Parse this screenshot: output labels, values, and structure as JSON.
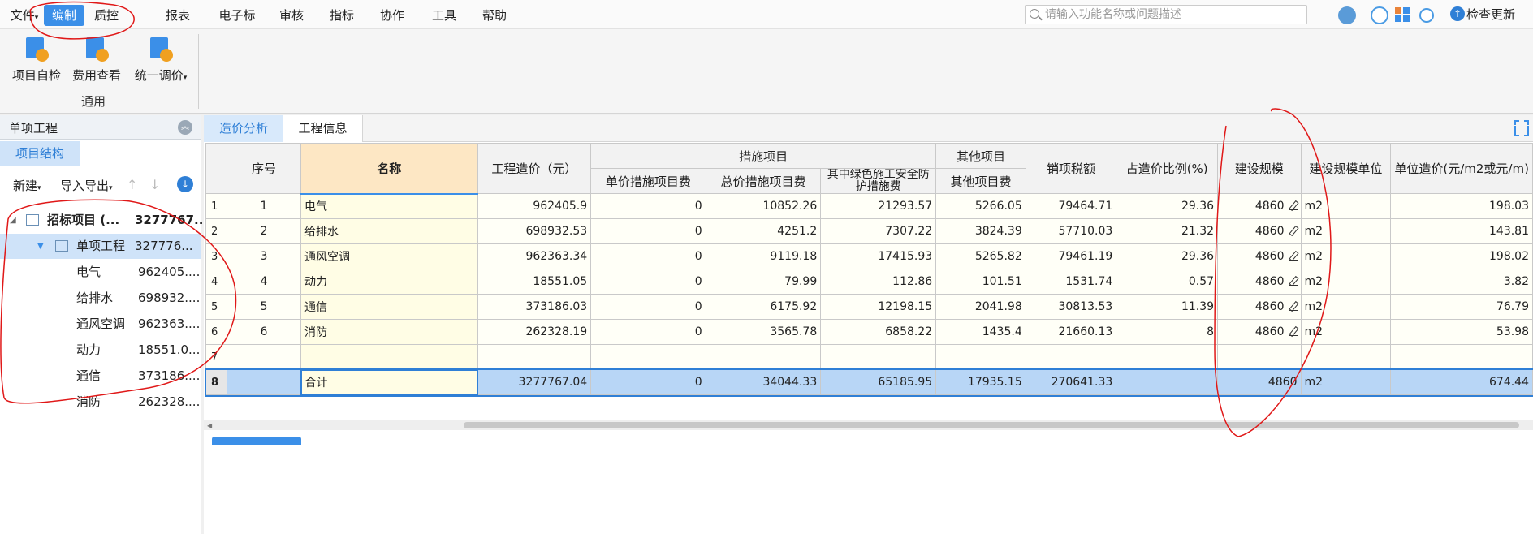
{
  "menu": {
    "items": [
      "文件",
      "编制",
      "质控",
      "报表",
      "电子标",
      "审核",
      "指标",
      "协作",
      "工具",
      "帮助"
    ],
    "active_index": 1
  },
  "search": {
    "placeholder": "请输入功能名称或问题描述"
  },
  "toolbar_right": {
    "check_update": "检查更新"
  },
  "ribbon": {
    "buttons": [
      "项目自检",
      "费用查看",
      "统一调价"
    ],
    "group_label": "通用"
  },
  "left": {
    "title": "单项工程",
    "tab": "项目结构",
    "actions": {
      "new": "新建",
      "import_export": "导入导出"
    },
    "tree": [
      {
        "label": "招标项目 (...",
        "value": "3277767..."
      },
      {
        "label": "单项工程",
        "value": "327776..."
      },
      {
        "label": "电气",
        "value": "962405...."
      },
      {
        "label": "给排水",
        "value": "698932...."
      },
      {
        "label": "通风空调",
        "value": "962363...."
      },
      {
        "label": "动力",
        "value": "18551.0..."
      },
      {
        "label": "通信",
        "value": "373186...."
      },
      {
        "label": "消防",
        "value": "262328...."
      }
    ]
  },
  "tabs": [
    "造价分析",
    "工程信息"
  ],
  "grid": {
    "headers": {
      "seq": "序号",
      "name": "名称",
      "cost": "工程造价（元）",
      "measures": "措施项目",
      "measures_unit": "单价措施项目费",
      "measures_total": "总价措施项目费",
      "green": "其中绿色施工安全防护措施费",
      "other": "其他项目",
      "other_sub": "其他项目费",
      "tax": "销项税额",
      "ratio": "占造价比例(%)",
      "scale": "建设规模",
      "scale_unit": "建设规模单位",
      "unit_cost": "单位造价(元/m2或元/m)"
    },
    "rows": [
      {
        "rn": "1",
        "seq": "1",
        "name": "电气",
        "cost": "962405.9",
        "mu": "0",
        "mt": "10852.26",
        "green": "21293.57",
        "other": "5266.05",
        "tax": "79464.71",
        "ratio": "29.36",
        "scale": "4860",
        "unit": "m2",
        "uc": "198.03"
      },
      {
        "rn": "2",
        "seq": "2",
        "name": "给排水",
        "cost": "698932.53",
        "mu": "0",
        "mt": "4251.2",
        "green": "7307.22",
        "other": "3824.39",
        "tax": "57710.03",
        "ratio": "21.32",
        "scale": "4860",
        "unit": "m2",
        "uc": "143.81"
      },
      {
        "rn": "3",
        "seq": "3",
        "name": "通风空调",
        "cost": "962363.34",
        "mu": "0",
        "mt": "9119.18",
        "green": "17415.93",
        "other": "5265.82",
        "tax": "79461.19",
        "ratio": "29.36",
        "scale": "4860",
        "unit": "m2",
        "uc": "198.02"
      },
      {
        "rn": "4",
        "seq": "4",
        "name": "动力",
        "cost": "18551.05",
        "mu": "0",
        "mt": "79.99",
        "green": "112.86",
        "other": "101.51",
        "tax": "1531.74",
        "ratio": "0.57",
        "scale": "4860",
        "unit": "m2",
        "uc": "3.82"
      },
      {
        "rn": "5",
        "seq": "5",
        "name": "通信",
        "cost": "373186.03",
        "mu": "0",
        "mt": "6175.92",
        "green": "12198.15",
        "other": "2041.98",
        "tax": "30813.53",
        "ratio": "11.39",
        "scale": "4860",
        "unit": "m2",
        "uc": "76.79"
      },
      {
        "rn": "6",
        "seq": "6",
        "name": "消防",
        "cost": "262328.19",
        "mu": "0",
        "mt": "3565.78",
        "green": "6858.22",
        "other": "1435.4",
        "tax": "21660.13",
        "ratio": "8",
        "scale": "4860",
        "unit": "m2",
        "uc": "53.98"
      }
    ],
    "empty_row": {
      "rn": "7"
    },
    "total": {
      "rn": "8",
      "name": "合计",
      "cost": "3277767.04",
      "mu": "0",
      "mt": "34044.33",
      "green": "65185.95",
      "other": "17935.15",
      "tax": "270641.33",
      "scale": "4860",
      "unit": "m2",
      "uc": "674.44"
    }
  },
  "colors": {
    "accent": "#3b8fe8",
    "annotation": "#e01818",
    "selected_row": "#b8d6f6"
  }
}
